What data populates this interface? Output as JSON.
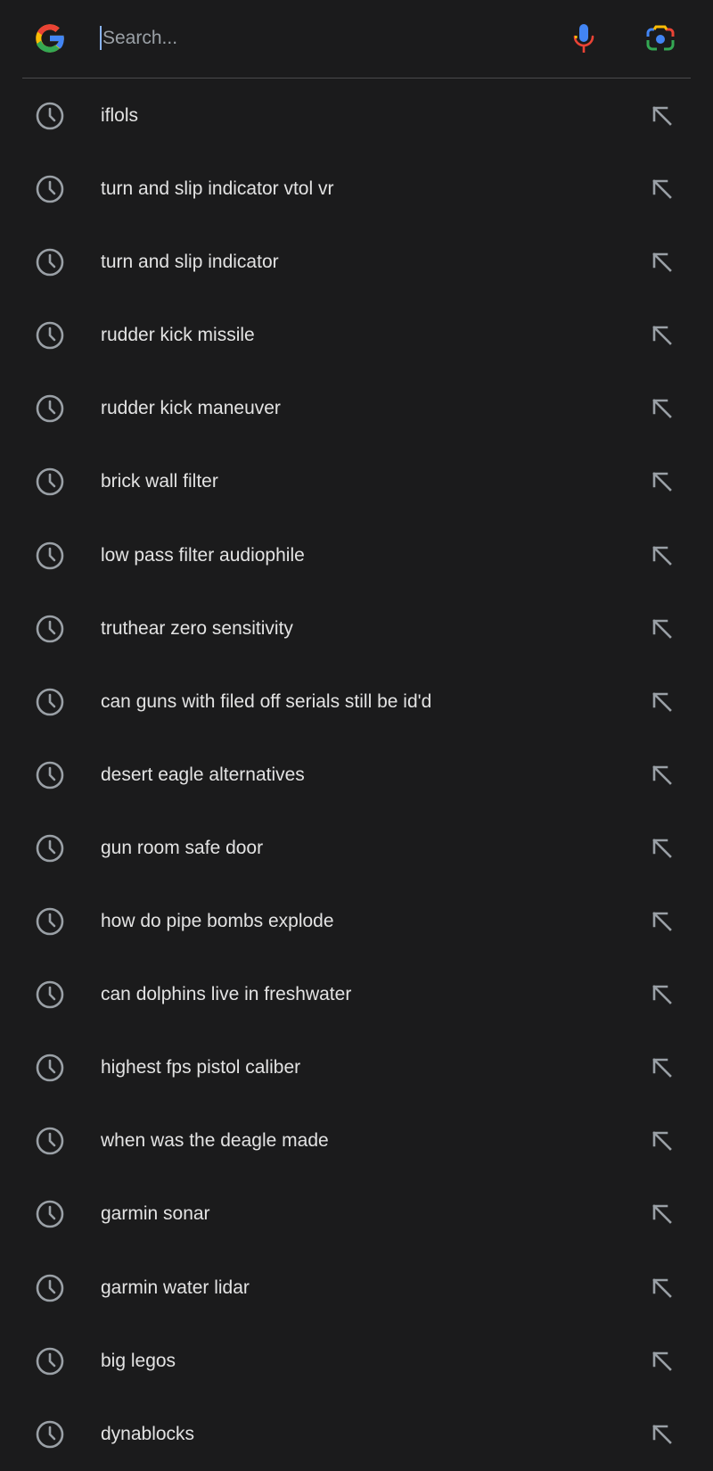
{
  "search": {
    "placeholder": "Search...",
    "value": ""
  },
  "colors": {
    "background": "#1b1b1c",
    "text": "#e3e3e3",
    "icon_gray": "#9aa0a6",
    "google_blue": "#4285F4",
    "google_red": "#EA4335",
    "google_yellow": "#FBBC05",
    "google_green": "#34A853"
  },
  "icons": {
    "logo": "google-g-logo",
    "voice": "microphone-icon",
    "lens": "google-lens-camera-icon",
    "history": "clock-icon",
    "fill": "arrow-up-left-icon"
  },
  "suggestions": [
    {
      "text": "iflols"
    },
    {
      "text": "turn and slip indicator vtol vr"
    },
    {
      "text": "turn and slip indicator"
    },
    {
      "text": "rudder kick missile"
    },
    {
      "text": "rudder kick maneuver"
    },
    {
      "text": "brick wall filter"
    },
    {
      "text": "low pass filter audiophile"
    },
    {
      "text": "truthear zero sensitivity"
    },
    {
      "text": "can guns with filed off serials still be id'd"
    },
    {
      "text": "desert eagle alternatives"
    },
    {
      "text": "gun room safe door"
    },
    {
      "text": "how do pipe bombs explode"
    },
    {
      "text": "can dolphins live in freshwater"
    },
    {
      "text": "highest fps pistol caliber"
    },
    {
      "text": "when was the deagle made"
    },
    {
      "text": "garmin sonar"
    },
    {
      "text": "garmin water lidar"
    },
    {
      "text": "big legos"
    },
    {
      "text": "dynablocks"
    }
  ]
}
